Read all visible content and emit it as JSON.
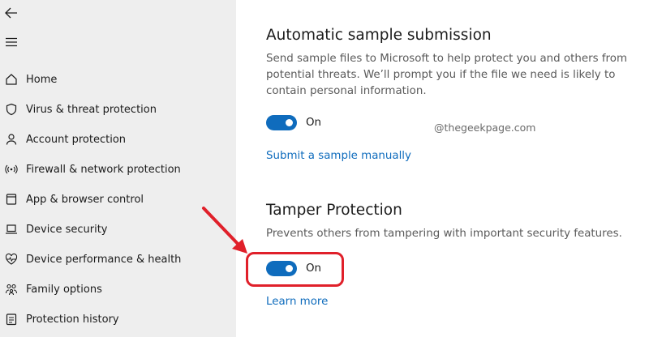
{
  "sidebar": {
    "back_icon": "back-arrow-icon",
    "menu_icon": "hamburger-menu-icon",
    "items": [
      {
        "label": "Home",
        "icon": "home-icon"
      },
      {
        "label": "Virus & threat protection",
        "icon": "shield-icon"
      },
      {
        "label": "Account protection",
        "icon": "person-icon"
      },
      {
        "label": "Firewall & network protection",
        "icon": "wifi-signal-icon"
      },
      {
        "label": "App & browser control",
        "icon": "app-window-icon"
      },
      {
        "label": "Device security",
        "icon": "laptop-icon"
      },
      {
        "label": "Device performance & health",
        "icon": "heart-pulse-icon"
      },
      {
        "label": "Family options",
        "icon": "family-icon"
      },
      {
        "label": "Protection history",
        "icon": "history-icon"
      }
    ]
  },
  "main": {
    "automatic_sample": {
      "title": "Automatic sample submission",
      "description": "Send sample files to Microsoft to help protect you and others from potential threats. We’ll prompt you if the file we need is likely to contain personal information.",
      "toggle_label": "On",
      "link": "Submit a sample manually"
    },
    "watermark": "@thegeekpage.com",
    "tamper": {
      "title": "Tamper Protection",
      "description": "Prevents others from tampering with important security features.",
      "toggle_label": "On",
      "link": "Learn more"
    }
  },
  "colors": {
    "accent": "#0f6cbd",
    "highlight": "#e0202a",
    "sidebar_bg": "#eeeeee"
  }
}
